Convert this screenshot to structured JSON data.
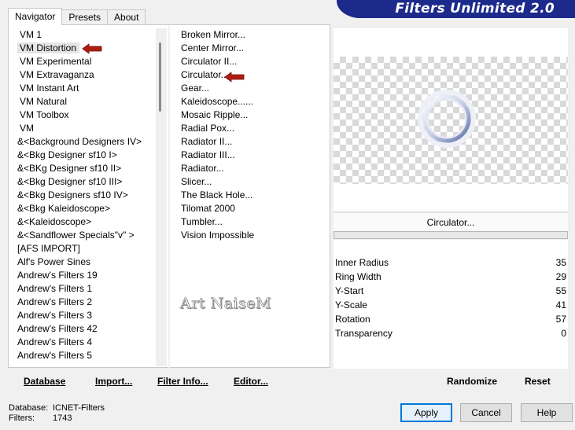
{
  "banner": {
    "title": "Filters Unlimited 2.0"
  },
  "tabs": [
    {
      "label": "Navigator",
      "active": true
    },
    {
      "label": "Presets",
      "active": false
    },
    {
      "label": "About",
      "active": false
    }
  ],
  "categories": [
    "VM 1",
    "VM Distortion",
    "VM Experimental",
    "VM Extravaganza",
    "VM Instant Art",
    "VM Natural",
    "VM Toolbox",
    "VM",
    "&<Background Designers IV>",
    "&<Bkg Designer sf10 I>",
    "&<BKg Designer sf10 II>",
    "&<Bkg Designer sf10 III>",
    "&<Bkg Designers sf10 IV>",
    "&<Bkg Kaleidoscope>",
    "&<Kaleidoscope>",
    "&<Sandflower Specials\"v\" >",
    "[AFS IMPORT]",
    "Alf's Power Sines",
    "Andrew's Filters 19",
    "Andrew's Filters 1",
    "Andrew's Filters 2",
    "Andrew's Filters 3",
    "Andrew's Filters 42",
    "Andrew's Filters 4",
    "Andrew's Filters 5"
  ],
  "selected_category": "VM Distortion",
  "filters": [
    "Broken Mirror...",
    "Center Mirror...",
    "Circulator II...",
    "Circulator...",
    "Gear...",
    "Kaleidoscope......",
    "Mosaic Ripple...",
    "Radial Pox...",
    "Radiator II...",
    "Radiator III...",
    "Radiator...",
    "Slicer...",
    "The Black Hole...",
    "Tilomat 2000",
    "Tumbler...",
    "Vision Impossible"
  ],
  "selected_filter": "Circulator...",
  "watermark": "Art NaiseM",
  "filter_name": "Circulator...",
  "params": [
    {
      "label": "Inner Radius",
      "value": "35"
    },
    {
      "label": "Ring Width",
      "value": "29"
    },
    {
      "label": "Y-Start",
      "value": "55"
    },
    {
      "label": "Y-Scale",
      "value": "41"
    },
    {
      "label": "Rotation",
      "value": "57"
    },
    {
      "label": "Transparency",
      "value": "0"
    }
  ],
  "toolbar": {
    "database": "Database",
    "import": "Import...",
    "filter_info": "Filter Info...",
    "editor": "Editor...",
    "randomize": "Randomize",
    "reset": "Reset"
  },
  "status": {
    "database_label": "Database:",
    "database_value": "ICNET-Filters",
    "filters_label": "Filters:",
    "filters_value": "1743"
  },
  "buttons": {
    "apply": "Apply",
    "cancel": "Cancel",
    "help": "Help"
  },
  "colors": {
    "banner": "#1c2a8c",
    "arrow": "#b01c12",
    "default_button": "#0078d7"
  }
}
